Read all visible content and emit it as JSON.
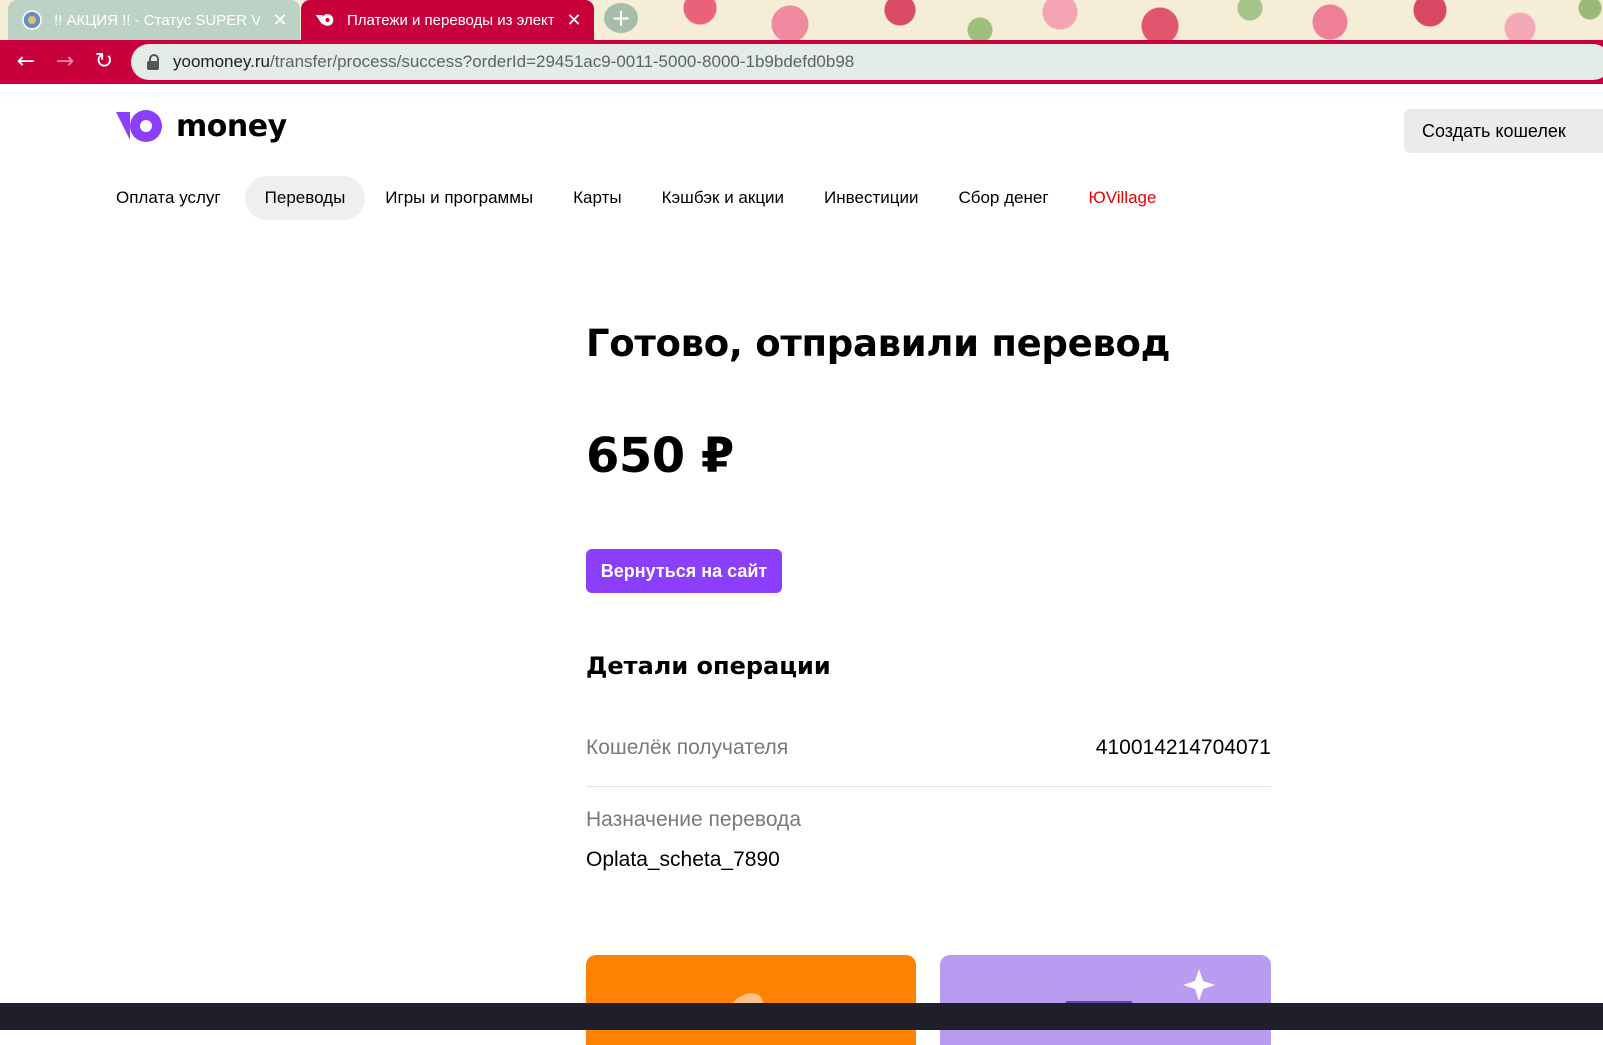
{
  "browser": {
    "tabs": [
      {
        "title": "!! АКЦИЯ !! - Статус SUPER VIP с",
        "active": false
      },
      {
        "title": "Платежи и переводы из электро",
        "active": true
      }
    ],
    "new_tab_label": "+",
    "url_host": "yoomoney.ru",
    "url_path": "/transfer/process/success?orderId=29451ac9-0011-5000-8000-1b9bdefd0b98",
    "accent_color": "#c8003c"
  },
  "header": {
    "logo_text": "money",
    "create_wallet_label": "Создать кошелек"
  },
  "nav": {
    "items": [
      "Оплата услуг",
      "Переводы",
      "Игры и программы",
      "Карты",
      "Кэшбэк и акции",
      "Инвестиции",
      "Сбор денег",
      "ЮVillage"
    ],
    "active": "Переводы"
  },
  "main": {
    "title": "Готово, отправили перевод",
    "amount": "650 ₽",
    "back_button_label": "Вернуться на сайт",
    "details_title": "Детали операции",
    "details": {
      "wallet_label": "Кошелёк получателя",
      "wallet_value": "410014214704071",
      "purpose_label": "Назначение перевода",
      "purpose_value": "Oplata_scheta_7890"
    }
  },
  "colors": {
    "brand_purple": "#8b3ffd",
    "promo_orange": "#ff8200",
    "promo_lilac": "#b79cf0",
    "village_red": "#e60000"
  }
}
